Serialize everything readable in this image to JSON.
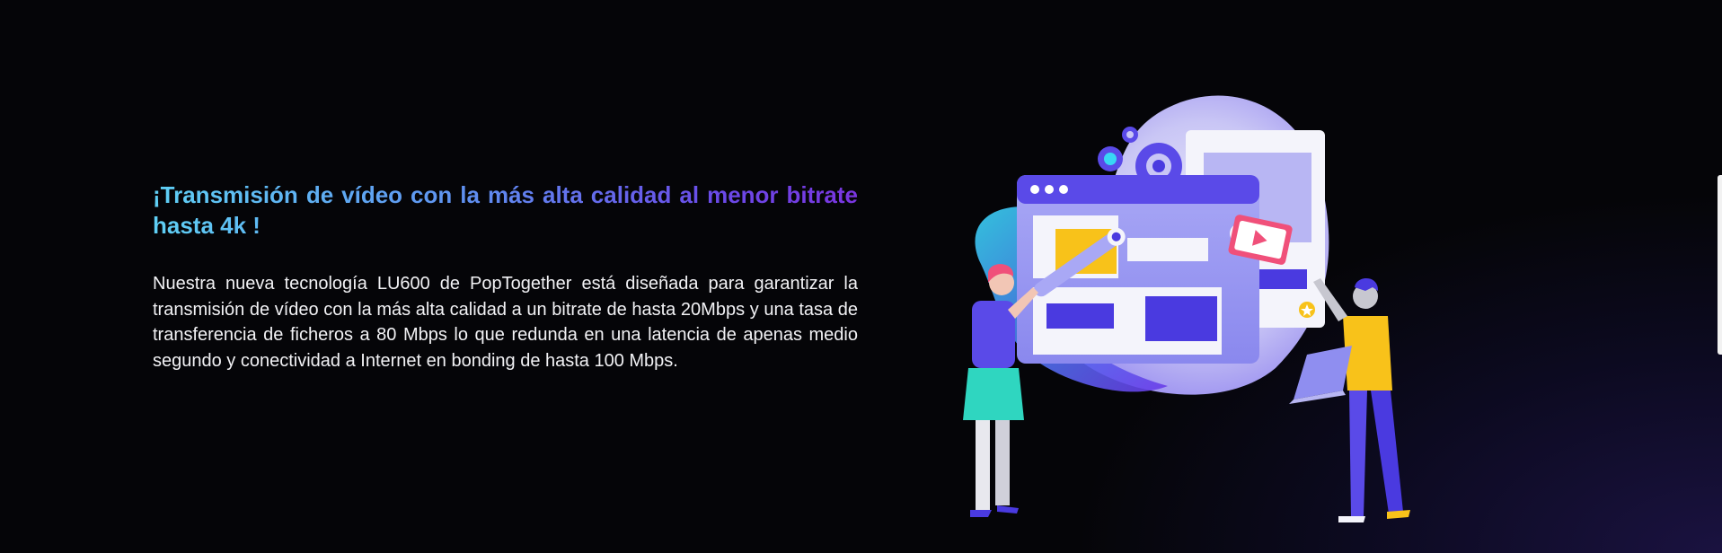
{
  "hero": {
    "headline": "¡Transmisión de vídeo con la más alta calidad al menor bitrate hasta 4k !",
    "body": "Nuestra nueva tecnología LU600 de PopTogether está diseñada para garantizar la transmisión de vídeo con la más alta calidad a un bitrate de hasta 20Mbps y una tasa de transferencia de ficheros a 80 Mbps lo que redunda en una latencia de apenas medio segundo y conectividad a Internet en bonding de hasta 100 Mbps."
  },
  "illustration": {
    "icon": "video-streaming-illustration",
    "colors": {
      "blob": "#c9c6f5",
      "window": "#8f8ef0",
      "accent_blue": "#4a3ae0",
      "accent_yellow": "#f8c21a",
      "accent_pink": "#f0507a",
      "skirt": "#2fd6c0"
    }
  },
  "theme": {
    "background": "#050508",
    "text": "#f2f2f5",
    "gradient_start": "#5fd0f5",
    "gradient_end": "#7a35e0"
  }
}
